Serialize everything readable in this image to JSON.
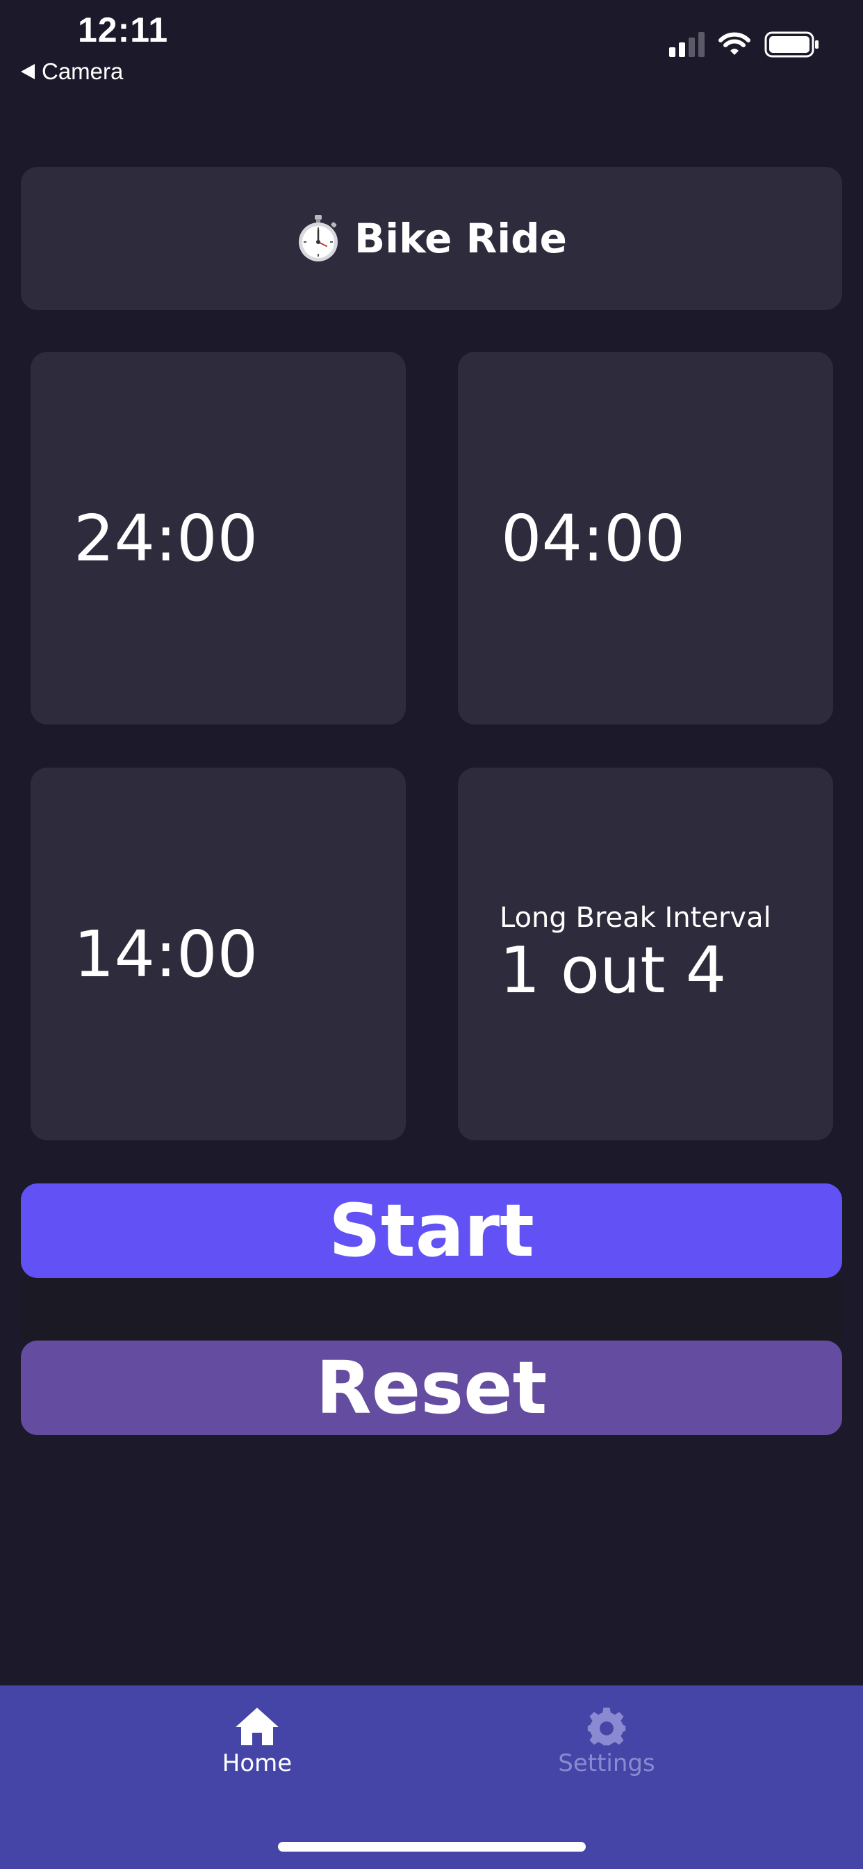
{
  "status_bar": {
    "time": "12:11",
    "back_label": "Camera",
    "icons": [
      "back-arrow-icon",
      "cellular-signal-icon",
      "wifi-icon",
      "battery-icon"
    ]
  },
  "header": {
    "icon": "stopwatch-icon",
    "title": "Bike Ride"
  },
  "tiles": {
    "work_duration": "24:00",
    "short_break": "04:00",
    "long_break": "14:00",
    "interval_caption": "Long Break Interval",
    "interval_value": "1 out 4"
  },
  "actions": {
    "start_label": "Start",
    "reset_label": "Reset"
  },
  "tab_bar": {
    "home_label": "Home",
    "settings_label": "Settings",
    "active": "Home"
  },
  "colors": {
    "background": "#1c1a2a",
    "card": "#2d2b3c",
    "start_button": "#6251f5",
    "reset_button": "#644ca0",
    "tab_bar": "#4545a8",
    "inactive_tab": "#8a8ad2"
  }
}
